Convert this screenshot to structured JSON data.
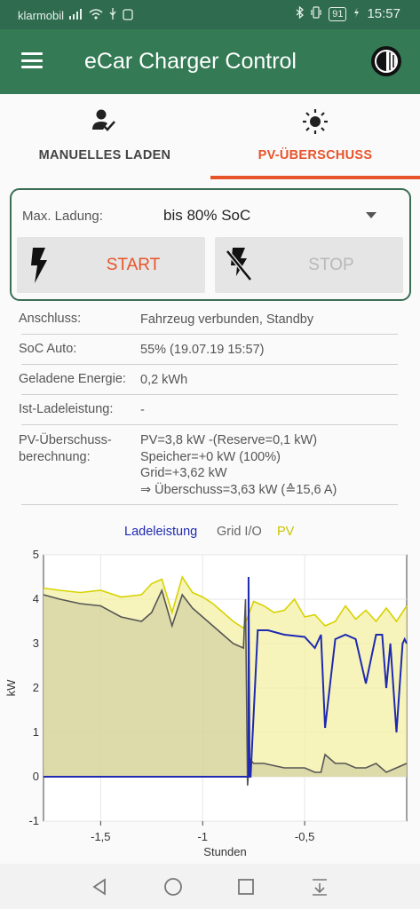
{
  "status_bar": {
    "carrier": "klarmobil",
    "battery": "91",
    "time": "15:57"
  },
  "app_bar": {
    "title": "eCar Charger Control"
  },
  "tabs": [
    {
      "label": "MANUELLES LADEN",
      "icon": "person-check-icon",
      "active": false
    },
    {
      "label": "PV-ÜBERSCHUSS",
      "icon": "sun-icon",
      "active": true
    }
  ],
  "colors": {
    "accent": "#e8542a",
    "appbar": "#337a55",
    "statusbar": "#2f6b4f"
  },
  "control": {
    "max_label": "Max. Ladung:",
    "max_value": "bis 80% SoC",
    "start_label": "START",
    "stop_label": "STOP"
  },
  "info": [
    {
      "key": "Anschluss:",
      "value": [
        "Fahrzeug verbunden, Standby"
      ]
    },
    {
      "key": "SoC Auto:",
      "value": [
        "55% (19.07.19 15:57)"
      ]
    },
    {
      "key": "Geladene Energie:",
      "value": [
        "0,2 kWh"
      ]
    },
    {
      "key": "Ist-Ladeleistung:",
      "value": [
        "-"
      ]
    },
    {
      "key": "PV-Überschuss-\nberechnung:",
      "value": [
        "PV=3,8 kW -(Reserve=0,1 kW)",
        "Speicher=+0 kW (100%)",
        "Grid=+3,62 kW",
        "⇒ Überschuss=3,63 kW (≙15,6 A)"
      ]
    }
  ],
  "chart_data": {
    "type": "line",
    "xlabel": "Stunden",
    "ylabel": "kW",
    "xlim": [
      -1.78,
      0
    ],
    "ylim": [
      -1,
      5
    ],
    "xticks": [
      "-1,5",
      "-1",
      "-0,5"
    ],
    "xtick_values": [
      -1.5,
      -1,
      -0.5
    ],
    "yticks": [
      "5",
      "4",
      "3",
      "2",
      "1",
      "0",
      "-1"
    ],
    "ytick_values": [
      5,
      4,
      3,
      2,
      1,
      0,
      -1
    ],
    "grid": true,
    "legend_position": "top",
    "series": [
      {
        "name": "Ladeleistung",
        "color": "#1f2ab0",
        "x": [
          -1.78,
          -0.78,
          -0.775,
          -0.775,
          -0.77,
          -0.765,
          -0.73,
          -0.68,
          -0.6,
          -0.5,
          -0.45,
          -0.42,
          -0.4,
          -0.35,
          -0.3,
          -0.25,
          -0.2,
          -0.15,
          -0.12,
          -0.1,
          -0.08,
          -0.05,
          -0.02,
          -0.01,
          0
        ],
        "y": [
          0,
          0,
          0,
          4.5,
          0,
          0,
          3.3,
          3.3,
          3.2,
          3.15,
          2.9,
          3.2,
          1.1,
          3.1,
          3.2,
          3.1,
          2.1,
          3.2,
          3.2,
          2.0,
          3.0,
          1.0,
          3.0,
          3.1,
          3.0
        ]
      },
      {
        "name": "Grid I/O",
        "color": "#555555",
        "x": [
          -1.78,
          -1.7,
          -1.6,
          -1.5,
          -1.4,
          -1.3,
          -1.25,
          -1.2,
          -1.15,
          -1.1,
          -1.05,
          -1.0,
          -0.95,
          -0.9,
          -0.85,
          -0.8,
          -0.79,
          -0.78,
          -0.77,
          -0.75,
          -0.7,
          -0.6,
          -0.5,
          -0.45,
          -0.42,
          -0.4,
          -0.35,
          -0.3,
          -0.25,
          -0.2,
          -0.15,
          -0.1,
          -0.05,
          0
        ],
        "y": [
          4.1,
          4.0,
          3.9,
          3.85,
          3.6,
          3.5,
          3.7,
          4.2,
          3.4,
          4.1,
          3.8,
          3.6,
          3.4,
          3.2,
          3.0,
          2.9,
          4.0,
          -0.2,
          0.4,
          0.3,
          0.3,
          0.2,
          0.2,
          0.1,
          0.1,
          0.5,
          0.3,
          0.3,
          0.2,
          0.2,
          0.3,
          0.1,
          0.2,
          0.3
        ]
      },
      {
        "name": "PV",
        "color": "#d7d200",
        "x": [
          -1.78,
          -1.7,
          -1.6,
          -1.5,
          -1.4,
          -1.3,
          -1.25,
          -1.2,
          -1.15,
          -1.1,
          -1.05,
          -1.0,
          -0.95,
          -0.9,
          -0.85,
          -0.8,
          -0.75,
          -0.7,
          -0.65,
          -0.6,
          -0.55,
          -0.5,
          -0.45,
          -0.4,
          -0.35,
          -0.3,
          -0.25,
          -0.2,
          -0.15,
          -0.1,
          -0.05,
          0
        ],
        "y": [
          4.25,
          4.2,
          4.15,
          4.2,
          4.05,
          4.1,
          4.35,
          4.45,
          3.7,
          4.5,
          4.15,
          4.05,
          3.9,
          3.7,
          3.5,
          3.35,
          3.95,
          3.85,
          3.7,
          3.75,
          4.0,
          3.6,
          3.65,
          3.4,
          3.5,
          3.85,
          3.55,
          3.75,
          3.5,
          3.8,
          3.5,
          3.85
        ]
      }
    ]
  }
}
